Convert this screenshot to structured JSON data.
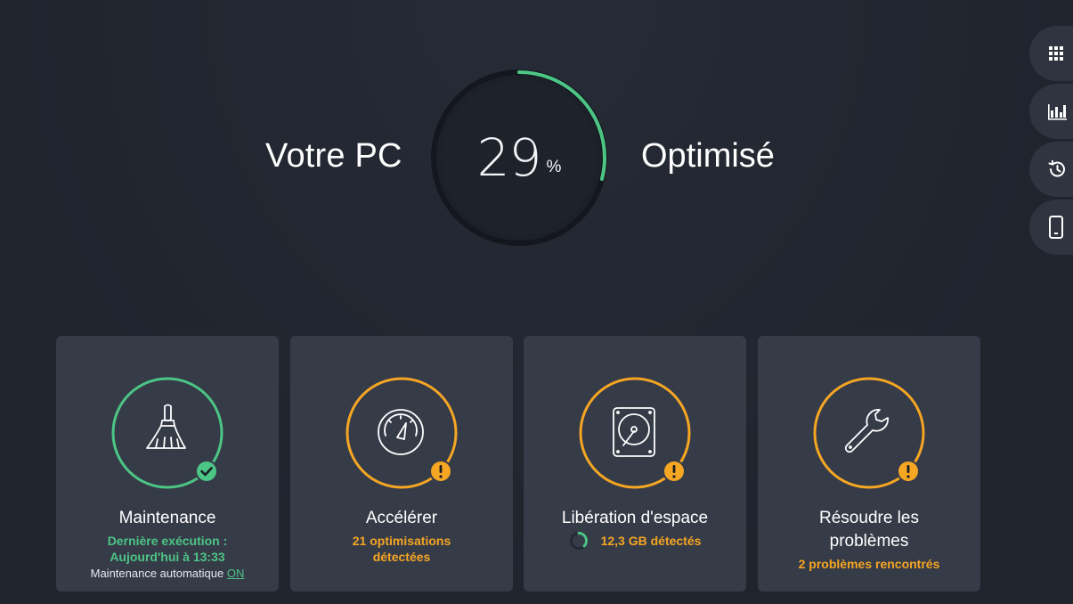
{
  "hero": {
    "left_text": "Votre PC",
    "right_text": "Optimisé",
    "score_value": "29",
    "score_unit": "%",
    "score_percent": 29
  },
  "rail": [
    {
      "name": "apps",
      "icon": "grid-icon"
    },
    {
      "name": "stats",
      "icon": "bar-chart-icon"
    },
    {
      "name": "history",
      "icon": "history-clock-icon"
    },
    {
      "name": "mobile",
      "icon": "phone-icon"
    }
  ],
  "cards": [
    {
      "title": "Maintenance",
      "status_line1": "Dernière exécution :",
      "status_line2": "Aujourd'hui à 13:33",
      "auto_label": "Maintenance automatique",
      "auto_value": "ON",
      "icon": "broom-icon",
      "badge": "check-badge-icon",
      "ring_color": "#4cc585"
    },
    {
      "title": "Accélérer",
      "status_line1": "21 optimisations",
      "status_line2": "détectées",
      "icon": "speedometer-icon",
      "badge": "warning-badge-icon",
      "ring_color": "#f5a623"
    },
    {
      "title": "Libération d'espace",
      "status_line1": "12,3 GB détectés",
      "icon": "hard-drive-icon",
      "badge": "warning-badge-icon",
      "ring_color": "#f5a623"
    },
    {
      "title_line1": "Résoudre les",
      "title_line2": "problèmes",
      "status_line1": "2 problèmes rencontrés",
      "icon": "wrench-icon",
      "badge": "warning-badge-icon",
      "ring_color": "#f5a623"
    }
  ],
  "colors": {
    "accent_green": "#4cc585",
    "accent_orange": "#f5a623",
    "card_bg": "#363b48",
    "page_bg": "#232731"
  }
}
